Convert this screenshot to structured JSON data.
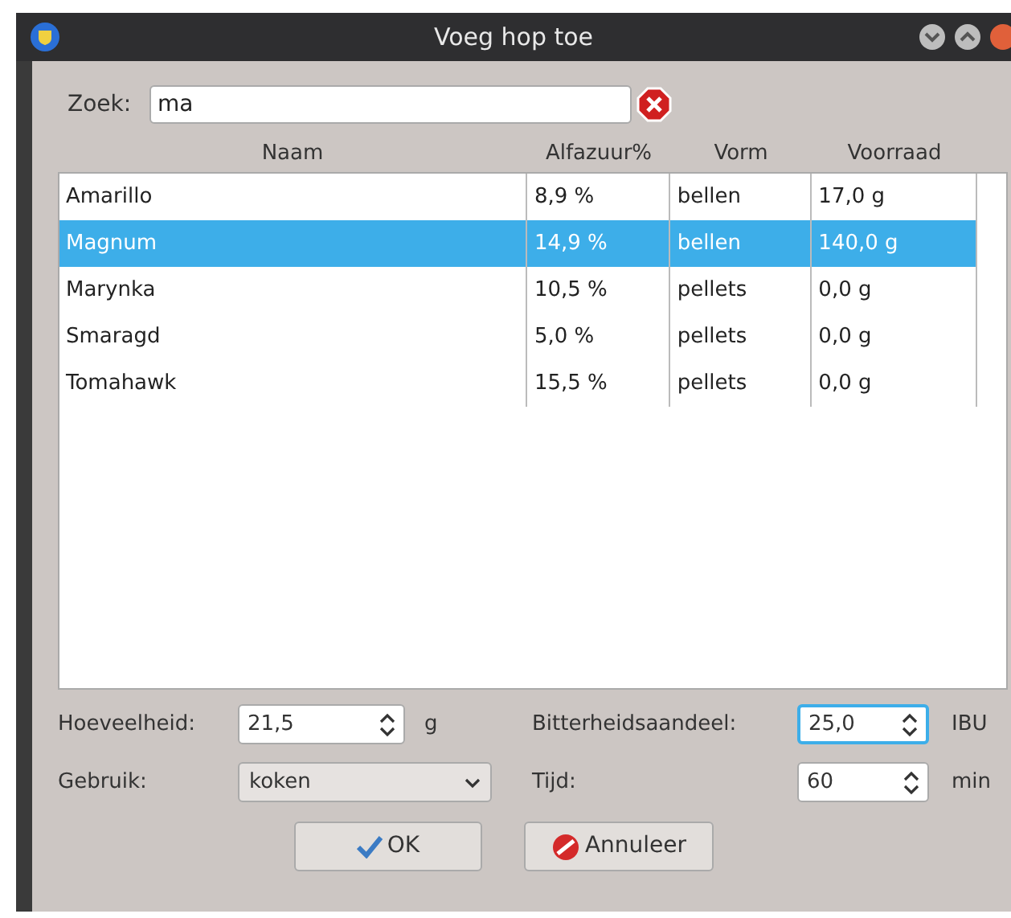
{
  "window": {
    "title": "Voeg hop toe"
  },
  "search": {
    "label": "Zoek:",
    "value": "ma"
  },
  "table": {
    "columns": [
      "Naam",
      "Alfazuur%",
      "Vorm",
      "Voorraad"
    ],
    "rows": [
      {
        "cells": [
          "Amarillo",
          "8,9 %",
          "bellen",
          "17,0 g"
        ],
        "selected": false
      },
      {
        "cells": [
          "Magnum",
          "14,9 %",
          "bellen",
          "140,0 g"
        ],
        "selected": true
      },
      {
        "cells": [
          "Marynka",
          "10,5 %",
          "pellets",
          "0,0 g"
        ],
        "selected": false
      },
      {
        "cells": [
          "Smaragd",
          "5,0 %",
          "pellets",
          "0,0 g"
        ],
        "selected": false
      },
      {
        "cells": [
          "Tomahawk",
          "15,5 %",
          "pellets",
          "0,0 g"
        ],
        "selected": false
      }
    ]
  },
  "fields": [
    {
      "label": "Hoeveelheid:",
      "kind": "spin",
      "value": "21,5",
      "unit": "g",
      "focused": false
    },
    {
      "label": "Bitterheidsaandeel:",
      "kind": "spin",
      "value": "25,0",
      "unit": "IBU",
      "focused": true
    },
    {
      "label": "Gebruik:",
      "kind": "combo",
      "value": "koken",
      "focused": false
    },
    {
      "label": "Tijd:",
      "kind": "spin",
      "value": "60",
      "unit": "min",
      "focused": false
    }
  ],
  "buttons": [
    {
      "label": "OK",
      "kind": "ok"
    },
    {
      "label": "Annuleer",
      "kind": "cancel"
    }
  ]
}
